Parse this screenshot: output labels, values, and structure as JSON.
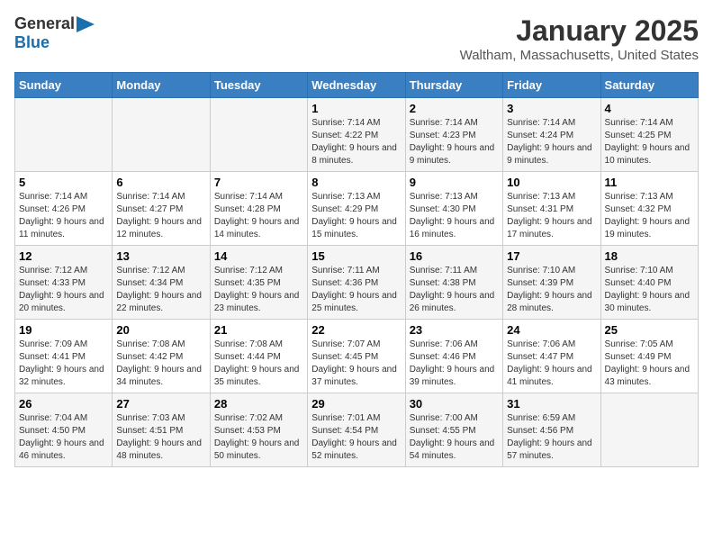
{
  "logo": {
    "line1": "General",
    "line2": "Blue"
  },
  "header": {
    "month": "January 2025",
    "location": "Waltham, Massachusetts, United States"
  },
  "weekdays": [
    "Sunday",
    "Monday",
    "Tuesday",
    "Wednesday",
    "Thursday",
    "Friday",
    "Saturday"
  ],
  "weeks": [
    [
      {
        "day": "",
        "sunrise": "",
        "sunset": "",
        "daylight": ""
      },
      {
        "day": "",
        "sunrise": "",
        "sunset": "",
        "daylight": ""
      },
      {
        "day": "",
        "sunrise": "",
        "sunset": "",
        "daylight": ""
      },
      {
        "day": "1",
        "sunrise": "Sunrise: 7:14 AM",
        "sunset": "Sunset: 4:22 PM",
        "daylight": "Daylight: 9 hours and 8 minutes."
      },
      {
        "day": "2",
        "sunrise": "Sunrise: 7:14 AM",
        "sunset": "Sunset: 4:23 PM",
        "daylight": "Daylight: 9 hours and 9 minutes."
      },
      {
        "day": "3",
        "sunrise": "Sunrise: 7:14 AM",
        "sunset": "Sunset: 4:24 PM",
        "daylight": "Daylight: 9 hours and 9 minutes."
      },
      {
        "day": "4",
        "sunrise": "Sunrise: 7:14 AM",
        "sunset": "Sunset: 4:25 PM",
        "daylight": "Daylight: 9 hours and 10 minutes."
      }
    ],
    [
      {
        "day": "5",
        "sunrise": "Sunrise: 7:14 AM",
        "sunset": "Sunset: 4:26 PM",
        "daylight": "Daylight: 9 hours and 11 minutes."
      },
      {
        "day": "6",
        "sunrise": "Sunrise: 7:14 AM",
        "sunset": "Sunset: 4:27 PM",
        "daylight": "Daylight: 9 hours and 12 minutes."
      },
      {
        "day": "7",
        "sunrise": "Sunrise: 7:14 AM",
        "sunset": "Sunset: 4:28 PM",
        "daylight": "Daylight: 9 hours and 14 minutes."
      },
      {
        "day": "8",
        "sunrise": "Sunrise: 7:13 AM",
        "sunset": "Sunset: 4:29 PM",
        "daylight": "Daylight: 9 hours and 15 minutes."
      },
      {
        "day": "9",
        "sunrise": "Sunrise: 7:13 AM",
        "sunset": "Sunset: 4:30 PM",
        "daylight": "Daylight: 9 hours and 16 minutes."
      },
      {
        "day": "10",
        "sunrise": "Sunrise: 7:13 AM",
        "sunset": "Sunset: 4:31 PM",
        "daylight": "Daylight: 9 hours and 17 minutes."
      },
      {
        "day": "11",
        "sunrise": "Sunrise: 7:13 AM",
        "sunset": "Sunset: 4:32 PM",
        "daylight": "Daylight: 9 hours and 19 minutes."
      }
    ],
    [
      {
        "day": "12",
        "sunrise": "Sunrise: 7:12 AM",
        "sunset": "Sunset: 4:33 PM",
        "daylight": "Daylight: 9 hours and 20 minutes."
      },
      {
        "day": "13",
        "sunrise": "Sunrise: 7:12 AM",
        "sunset": "Sunset: 4:34 PM",
        "daylight": "Daylight: 9 hours and 22 minutes."
      },
      {
        "day": "14",
        "sunrise": "Sunrise: 7:12 AM",
        "sunset": "Sunset: 4:35 PM",
        "daylight": "Daylight: 9 hours and 23 minutes."
      },
      {
        "day": "15",
        "sunrise": "Sunrise: 7:11 AM",
        "sunset": "Sunset: 4:36 PM",
        "daylight": "Daylight: 9 hours and 25 minutes."
      },
      {
        "day": "16",
        "sunrise": "Sunrise: 7:11 AM",
        "sunset": "Sunset: 4:38 PM",
        "daylight": "Daylight: 9 hours and 26 minutes."
      },
      {
        "day": "17",
        "sunrise": "Sunrise: 7:10 AM",
        "sunset": "Sunset: 4:39 PM",
        "daylight": "Daylight: 9 hours and 28 minutes."
      },
      {
        "day": "18",
        "sunrise": "Sunrise: 7:10 AM",
        "sunset": "Sunset: 4:40 PM",
        "daylight": "Daylight: 9 hours and 30 minutes."
      }
    ],
    [
      {
        "day": "19",
        "sunrise": "Sunrise: 7:09 AM",
        "sunset": "Sunset: 4:41 PM",
        "daylight": "Daylight: 9 hours and 32 minutes."
      },
      {
        "day": "20",
        "sunrise": "Sunrise: 7:08 AM",
        "sunset": "Sunset: 4:42 PM",
        "daylight": "Daylight: 9 hours and 34 minutes."
      },
      {
        "day": "21",
        "sunrise": "Sunrise: 7:08 AM",
        "sunset": "Sunset: 4:44 PM",
        "daylight": "Daylight: 9 hours and 35 minutes."
      },
      {
        "day": "22",
        "sunrise": "Sunrise: 7:07 AM",
        "sunset": "Sunset: 4:45 PM",
        "daylight": "Daylight: 9 hours and 37 minutes."
      },
      {
        "day": "23",
        "sunrise": "Sunrise: 7:06 AM",
        "sunset": "Sunset: 4:46 PM",
        "daylight": "Daylight: 9 hours and 39 minutes."
      },
      {
        "day": "24",
        "sunrise": "Sunrise: 7:06 AM",
        "sunset": "Sunset: 4:47 PM",
        "daylight": "Daylight: 9 hours and 41 minutes."
      },
      {
        "day": "25",
        "sunrise": "Sunrise: 7:05 AM",
        "sunset": "Sunset: 4:49 PM",
        "daylight": "Daylight: 9 hours and 43 minutes."
      }
    ],
    [
      {
        "day": "26",
        "sunrise": "Sunrise: 7:04 AM",
        "sunset": "Sunset: 4:50 PM",
        "daylight": "Daylight: 9 hours and 46 minutes."
      },
      {
        "day": "27",
        "sunrise": "Sunrise: 7:03 AM",
        "sunset": "Sunset: 4:51 PM",
        "daylight": "Daylight: 9 hours and 48 minutes."
      },
      {
        "day": "28",
        "sunrise": "Sunrise: 7:02 AM",
        "sunset": "Sunset: 4:53 PM",
        "daylight": "Daylight: 9 hours and 50 minutes."
      },
      {
        "day": "29",
        "sunrise": "Sunrise: 7:01 AM",
        "sunset": "Sunset: 4:54 PM",
        "daylight": "Daylight: 9 hours and 52 minutes."
      },
      {
        "day": "30",
        "sunrise": "Sunrise: 7:00 AM",
        "sunset": "Sunset: 4:55 PM",
        "daylight": "Daylight: 9 hours and 54 minutes."
      },
      {
        "day": "31",
        "sunrise": "Sunrise: 6:59 AM",
        "sunset": "Sunset: 4:56 PM",
        "daylight": "Daylight: 9 hours and 57 minutes."
      },
      {
        "day": "",
        "sunrise": "",
        "sunset": "",
        "daylight": ""
      }
    ]
  ]
}
